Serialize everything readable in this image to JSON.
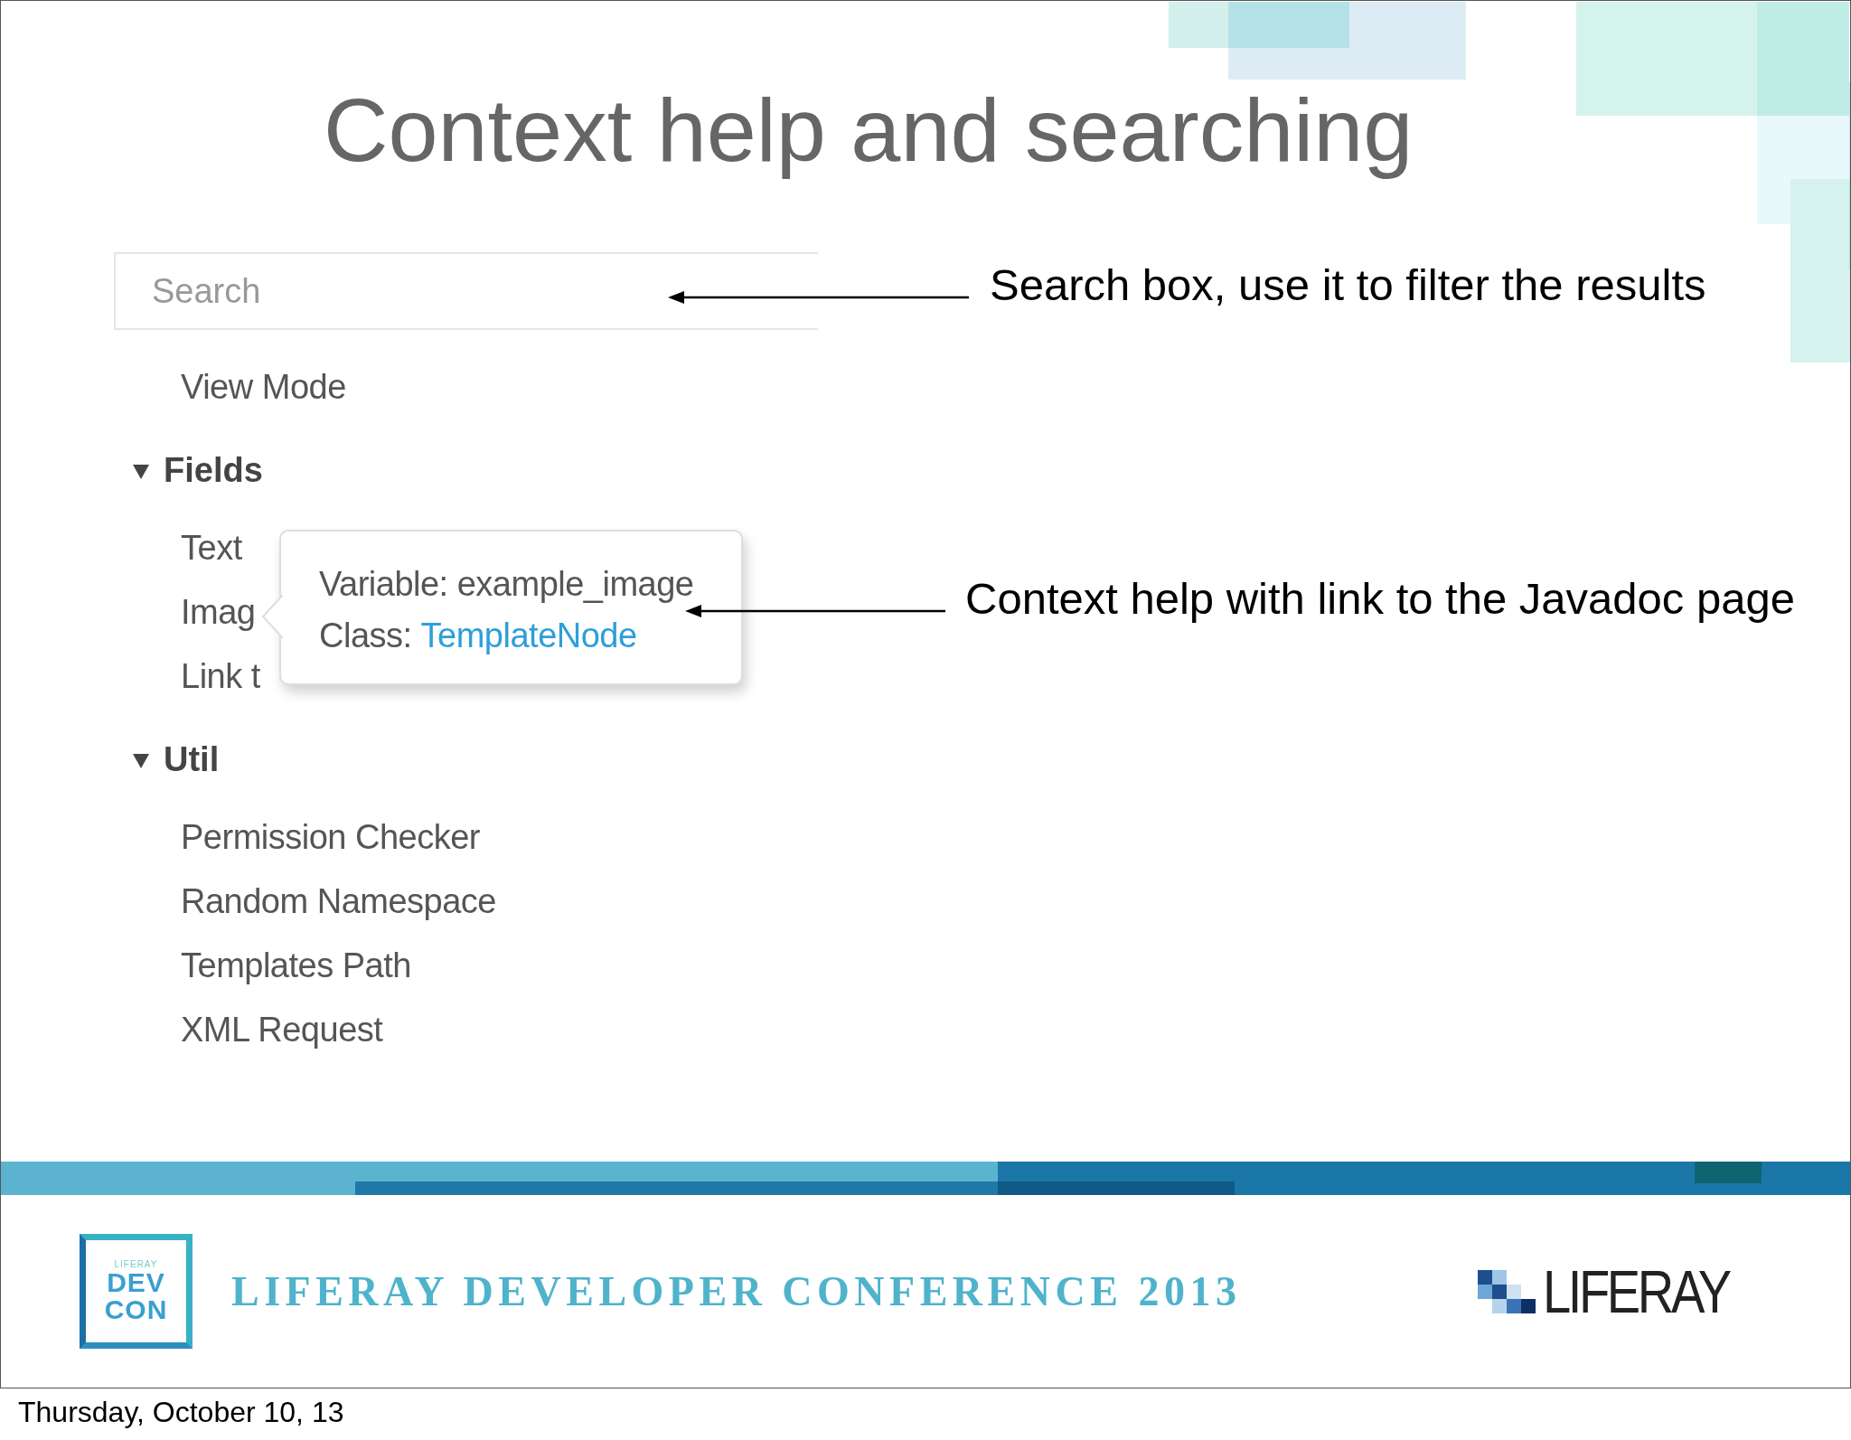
{
  "slide": {
    "title": "Context help and searching"
  },
  "search_field": {
    "placeholder": "Search"
  },
  "tree": [
    {
      "kind": "item",
      "label": "View Mode"
    },
    {
      "kind": "group",
      "label": "Fields",
      "expanded": true,
      "children": [
        {
          "label": "Text"
        },
        {
          "label": "Imag"
        },
        {
          "label": "Link t"
        }
      ]
    },
    {
      "kind": "group",
      "label": "Util",
      "expanded": true,
      "children": [
        {
          "label": "Permission Checker"
        },
        {
          "label": "Random Namespace"
        },
        {
          "label": "Templates Path"
        },
        {
          "label": "XML Request"
        }
      ]
    }
  ],
  "tooltip": {
    "variable_line": "Variable: example_image",
    "class_label": "Class:",
    "class_link": "TemplateNode"
  },
  "annotations": [
    {
      "text": "Search box, use it to filter the results"
    },
    {
      "text": "Context help with link to the Javadoc page"
    }
  ],
  "footer": {
    "conference": "LIFERAY DEVELOPER CONFERENCE 2013",
    "devcon_logo": [
      "LIFERAY",
      "DEV",
      "CON"
    ],
    "brand": "LIFERAY"
  },
  "date": "Thursday, October 10, 13"
}
